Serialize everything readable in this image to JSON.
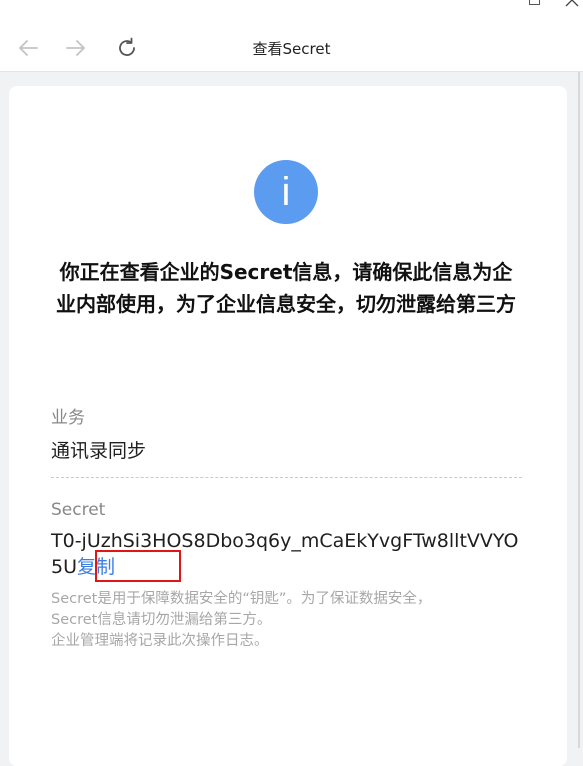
{
  "window": {
    "title": "查看Secret",
    "back_icon": "back-arrow-icon",
    "forward_icon": "forward-arrow-icon",
    "refresh_icon": "refresh-icon"
  },
  "info_icon_glyph": "i",
  "heading": "你正在查看企业的Secret信息，请确保此信息为企业内部使用，为了企业信息安全，切勿泄露给第三方",
  "business": {
    "label": "业务",
    "value": "通讯录同步"
  },
  "secret": {
    "label": "Secret",
    "value": "T0-jUzhSi3HOS8Dbo3q6y_mCaEkYvgFTw8lltVVYO5U",
    "copy_label": "复制"
  },
  "note": {
    "line1": "Secret是用于保障数据安全的“钥匙”。为了保证数据安全，",
    "line2": "Secret信息请切勿泄漏给第三方。",
    "line3": "企业管理端将记录此次操作日志。"
  },
  "colors": {
    "info_blue": "#5b9bf0",
    "link_blue": "#3c7de6",
    "highlight_red": "#e01515"
  }
}
